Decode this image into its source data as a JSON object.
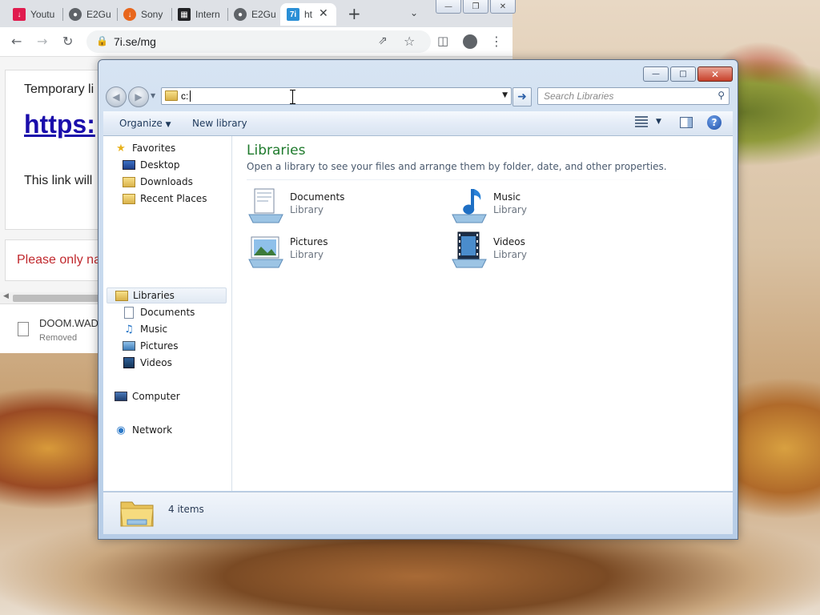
{
  "browser": {
    "tabs": [
      {
        "label": "Youtu",
        "icon": "download-icon",
        "color": "#e01b4e"
      },
      {
        "label": "E2Gu",
        "icon": "globe-icon",
        "color": "#5f6368"
      },
      {
        "label": "Sony",
        "icon": "download-icon",
        "color": "#e8661c"
      },
      {
        "label": "Intern",
        "icon": "archive-icon",
        "color": "#202124"
      },
      {
        "label": "E2Gu",
        "icon": "globe-icon",
        "color": "#5f6368"
      },
      {
        "label": "ht",
        "icon": "7i-icon",
        "color": "#2a8fd6",
        "icon_text": "7i"
      }
    ],
    "url": "7i.se/mg",
    "page": {
      "temp_text": "Temporary li",
      "link_text": "https:",
      "expiry_text": "This link will",
      "warning_text": "Please only na"
    },
    "download": {
      "filename": "DOOM.WAD",
      "status": "Removed"
    }
  },
  "explorer": {
    "address_value": "c:",
    "search_placeholder": "Search Libraries",
    "commands": {
      "organize": "Organize",
      "new_library": "New library"
    },
    "nav": {
      "favorites": {
        "label": "Favorites",
        "items": [
          "Desktop",
          "Downloads",
          "Recent Places"
        ]
      },
      "libraries": {
        "label": "Libraries",
        "items": [
          "Documents",
          "Music",
          "Pictures",
          "Videos"
        ]
      },
      "computer": "Computer",
      "network": "Network"
    },
    "content": {
      "title": "Libraries",
      "description": "Open a library to see your files and arrange them by folder, date, and other properties.",
      "libraries": [
        {
          "name": "Documents",
          "type": "Library",
          "icon": "documents-library-icon"
        },
        {
          "name": "Music",
          "type": "Library",
          "icon": "music-library-icon"
        },
        {
          "name": "Pictures",
          "type": "Library",
          "icon": "pictures-library-icon"
        },
        {
          "name": "Videos",
          "type": "Library",
          "icon": "videos-library-icon"
        }
      ]
    },
    "status": {
      "count": "4 items"
    },
    "colors": {
      "title_green": "#1e7a2c",
      "link_blue": "#1a0dab",
      "warning_red": "#c0282d"
    }
  }
}
